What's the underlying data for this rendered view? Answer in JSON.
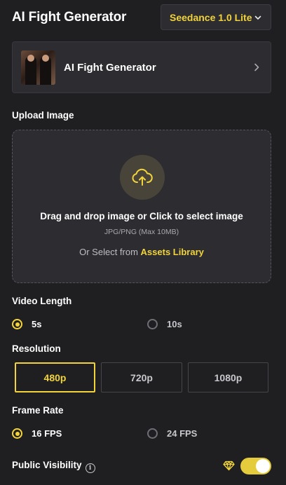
{
  "header": {
    "title": "AI Fight Generator",
    "model_select": "Seedance 1.0 Lite"
  },
  "template_card": {
    "name": "AI Fight Generator"
  },
  "upload": {
    "label": "Upload Image",
    "primary": "Drag and drop image or Click to select image",
    "hint": "JPG/PNG (Max 10MB)",
    "assets_prefix": "Or Select from",
    "assets_link": "Assets Library"
  },
  "video_length": {
    "label": "Video Length",
    "options": [
      "5s",
      "10s"
    ],
    "selected": "5s"
  },
  "resolution": {
    "label": "Resolution",
    "options": [
      "480p",
      "720p",
      "1080p"
    ],
    "selected": "480p"
  },
  "frame_rate": {
    "label": "Frame Rate",
    "options": [
      "16 FPS",
      "24 FPS"
    ],
    "selected": "16 FPS"
  },
  "public_visibility": {
    "label": "Public Visibility",
    "enabled": true
  },
  "colors": {
    "accent": "#f2d43a",
    "background": "#1f1f22",
    "panel": "#2c2c31"
  }
}
